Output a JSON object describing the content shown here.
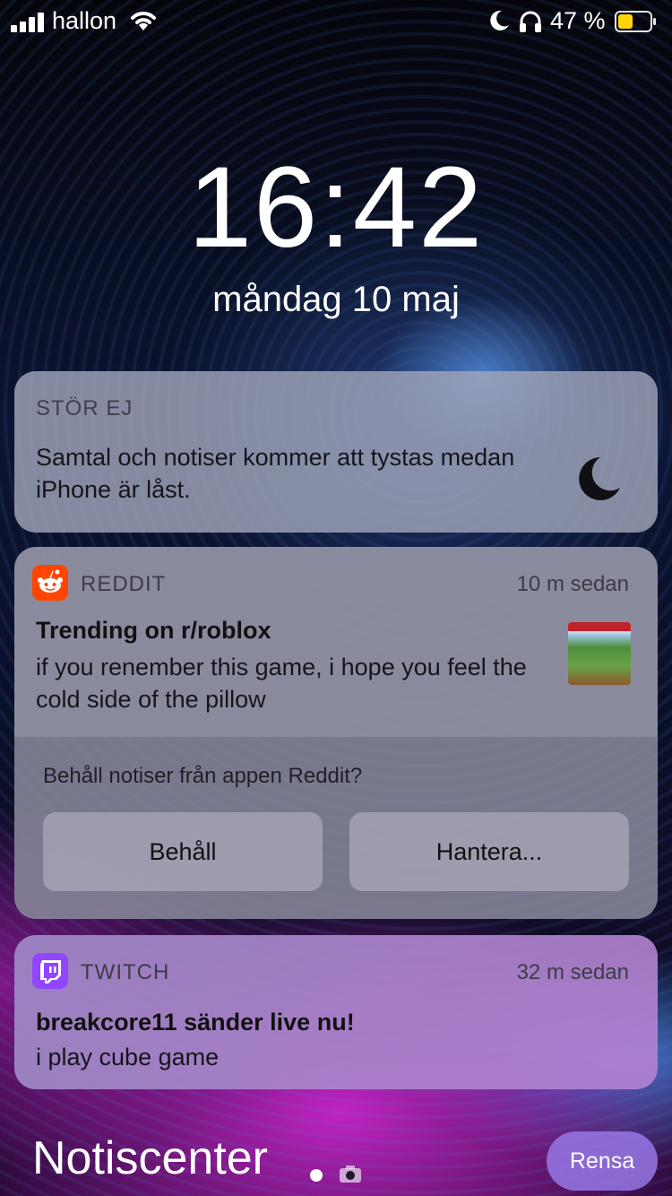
{
  "status_bar": {
    "carrier": "hallon",
    "battery_percent": "47 %",
    "battery_level": 0.47,
    "battery_color": "#ffd60a"
  },
  "lock_screen": {
    "time": "16:42",
    "date": "måndag 10 maj"
  },
  "dnd_card": {
    "title": "STÖR EJ",
    "body": "Samtal och notiser kommer att tystas medan iPhone är låst.",
    "icon": "moon-icon"
  },
  "reddit_card": {
    "app_name": "REDDIT",
    "time_ago": "10 m sedan",
    "title": "Trending on r/roblox",
    "body": "if you renember this game, i hope you feel the cold side of the pillow",
    "prompt": "Behåll notiser från appen Reddit?",
    "keep_label": "Behåll",
    "manage_label": "Hantera...",
    "icon_color": "#ff4500"
  },
  "twitch_card": {
    "app_name": "TWITCH",
    "time_ago": "32 m sedan",
    "title": "breakcore11 sänder live nu!",
    "body": "i play cube game",
    "icon_color": "#9146ff"
  },
  "footer": {
    "title": "Notiscenter",
    "clear_label": "Rensa"
  }
}
